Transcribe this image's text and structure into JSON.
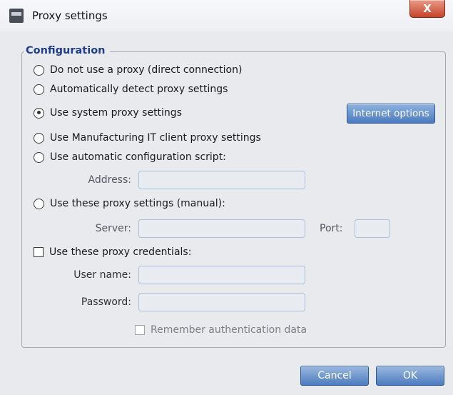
{
  "window": {
    "title": "Proxy settings",
    "close_label": "X"
  },
  "configuration": {
    "legend": "Configuration",
    "options": {
      "no_proxy": "Do not use a proxy (direct connection)",
      "auto_detect": "Automatically detect proxy settings",
      "system_proxy": "Use system proxy settings",
      "mit_client": "Use Manufacturing IT client proxy settings",
      "auto_script": "Use automatic configuration script:",
      "manual": "Use these proxy settings (manual):"
    },
    "selected_option": "system_proxy",
    "internet_options_label": "Internet options",
    "address_label": "Address:",
    "address_value": "",
    "server_label": "Server:",
    "server_value": "",
    "port_label": "Port:",
    "port_value": "",
    "credentials_label": "Use these proxy credentials:",
    "credentials_checked": false,
    "username_label": "User name:",
    "username_value": "",
    "password_label": "Password:",
    "password_value": "",
    "remember_label": "Remember authentication data",
    "remember_checked": false
  },
  "footer": {
    "cancel_label": "Cancel",
    "ok_label": "OK"
  }
}
